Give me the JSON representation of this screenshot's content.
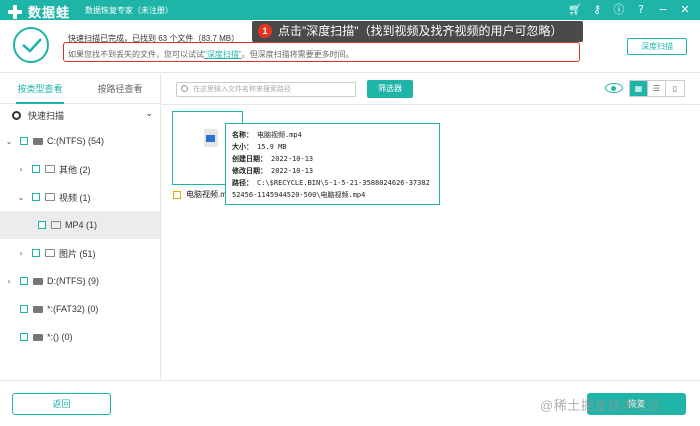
{
  "titlebar": {
    "brand": "数据蛙",
    "subtitle": "数据恢复专家（未注册）",
    "icons": [
      "cart-icon",
      "key-icon",
      "info-icon",
      "help-icon",
      "minimize-icon",
      "close-icon"
    ]
  },
  "status": {
    "line1": "快速扫描已完成，已找到 63 个文件（83.7 MB）",
    "line2_prefix": "如果您找不到丢失的文件，您可以试试",
    "line2_link": "\"深度扫描\"",
    "line2_suffix": "。但深度扫描将需要更多时间。",
    "tooltip_badge": "1",
    "tooltip_text": "点击\"深度扫描\"（找到视频及找齐视频的用户可忽略）",
    "deep_scan_label": "深度扫描"
  },
  "sidebar": {
    "tabs": [
      {
        "label": "按类型查看",
        "active": true
      },
      {
        "label": "按路径查看",
        "active": false
      }
    ],
    "quick_scan": "快速扫描",
    "tree": [
      {
        "label": "C:(NTFS) (54)",
        "level": 0,
        "expanded": true,
        "icon": "drive-icon"
      },
      {
        "label": "其他 (2)",
        "level": 1,
        "expanded": false,
        "icon": "folder-icon"
      },
      {
        "label": "视频 (1)",
        "level": 1,
        "expanded": true,
        "icon": "video-icon"
      },
      {
        "label": "MP4 (1)",
        "level": 2,
        "selected": true,
        "icon": "video-icon"
      },
      {
        "label": "图片 (51)",
        "level": 1,
        "expanded": false,
        "icon": "image-icon"
      },
      {
        "label": "D:(NTFS) (9)",
        "level": 0,
        "expanded": false,
        "icon": "drive-icon"
      },
      {
        "label": "*:(FAT32) (0)",
        "level": 0,
        "icon": "drive-icon"
      },
      {
        "label": "*:() (0)",
        "level": 0,
        "icon": "drive-icon"
      }
    ]
  },
  "content": {
    "search_placeholder": "在这里输入文件名称来搜索路径",
    "filter_label": "筛选器",
    "file_name": "电脑视频.mp4",
    "details": {
      "name_label": "名称：",
      "name_value": "电脑视频.mp4",
      "size_label": "大小：",
      "size_value": "15.9 MB",
      "created_label": "创建日期：",
      "created_value": "2022-10-13",
      "modified_label": "修改日期：",
      "modified_value": "2022-10-13",
      "path_label": "路径：",
      "path_value": "C:\\$RECYCLE.BIN\\S-1-5-21-3588024626-3738252456-1145944520-500\\电脑视频.mp4"
    }
  },
  "footer": {
    "back_label": "返回",
    "recover_label": "恢复",
    "watermark": "@稀土掘金技术社区"
  }
}
